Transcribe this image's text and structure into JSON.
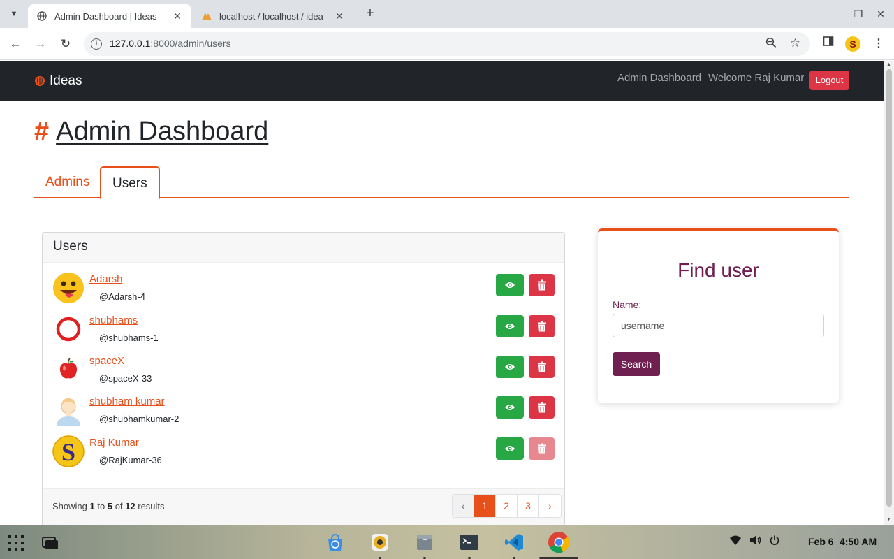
{
  "browser": {
    "tabs": [
      {
        "title": "Admin Dashboard | Ideas",
        "active": true
      },
      {
        "title": "localhost / localhost / idea",
        "active": false
      }
    ],
    "url_host": "127.0.0.1",
    "url_rest": ":8000/admin/users"
  },
  "navbar": {
    "brand": "Ideas",
    "links": [
      "Admin Dashboard",
      "Welcome Raj Kumar"
    ],
    "logout": "Logout"
  },
  "page": {
    "hash": "#",
    "title": "Admin Dashboard",
    "tabs": [
      "Admins",
      "Users"
    ],
    "active_tab": "Users"
  },
  "users_card": {
    "header": "Users",
    "users": [
      {
        "name": "Adarsh",
        "handle": "@Adarsh-4",
        "avatar": "smiley-emoji",
        "can_delete": true
      },
      {
        "name": "shubhams",
        "handle": "@shubhams-1",
        "avatar": "red-ring",
        "can_delete": true
      },
      {
        "name": "spaceX",
        "handle": "@spaceX-33",
        "avatar": "apple",
        "can_delete": true
      },
      {
        "name": "shubham kumar",
        "handle": "@shubhamkumar-2",
        "avatar": "person",
        "can_delete": true
      },
      {
        "name": "Raj Kumar",
        "handle": "@RajKumar-36",
        "avatar": "letter-s",
        "can_delete": false
      }
    ],
    "footer": {
      "showing_prefix": "Showing",
      "from": "1",
      "to_word": "to",
      "to": "5",
      "of_word": "of",
      "total": "12",
      "suffix": "results"
    },
    "pagination": {
      "prev": "‹",
      "pages": [
        "1",
        "2",
        "3"
      ],
      "current": "1",
      "next": "›"
    }
  },
  "find_user": {
    "title": "Find user",
    "label": "Name:",
    "placeholder": "username",
    "button": "Search"
  },
  "taskbar": {
    "date": "Feb 6",
    "time": "4:50 AM"
  },
  "colors": {
    "accent": "#e8501a",
    "navbar": "#212529",
    "danger": "#dc3545",
    "success": "#28a745",
    "plum": "#6f2050"
  }
}
